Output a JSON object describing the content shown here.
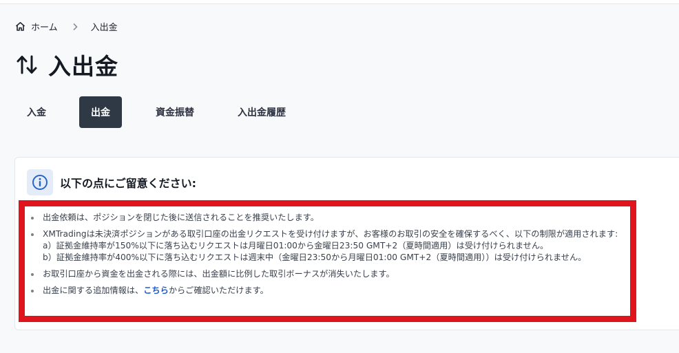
{
  "breadcrumb": {
    "home_label": "ホーム",
    "current_label": "入出金"
  },
  "page": {
    "title": "入出金"
  },
  "tabs": [
    {
      "label": "入金",
      "active": false
    },
    {
      "label": "出金",
      "active": true
    },
    {
      "label": "資金振替",
      "active": false
    },
    {
      "label": "入出金履歴",
      "active": false
    }
  ],
  "notice": {
    "title": "以下の点にご留意ください:",
    "items": [
      "出金依頼は、ポジションを閉じた後に送信されることを推奨いたします。",
      "XMTradingは未決済ポジションがある取引口座の出金リクエストを受け付けますが、お客様のお取引の安全を確保するべく、以下の制限が適用されます:",
      "a）証拠金維持率が150%以下に落ち込むリクエストは月曜日01:00から金曜日23:50 GMT+2（夏時間適用）は受け付けられません。",
      "b）証拠金維持率が400%以下に落ち込むリクエストは週末中（金曜日23:50から月曜日01:00 GMT+2（夏時間適用））は受け付けられません。",
      "お取引口座から資金を出金される際には、出金額に比例した取引ボーナスが消失いたします。"
    ],
    "last_item": {
      "prefix": "出金に関する追加情報は、",
      "link_text": "こちら",
      "suffix": "からご確認いただけます。"
    }
  },
  "colors": {
    "active_tab_bg": "#2f3845",
    "highlight_frame": "#e0141d",
    "link": "#1e5bd0",
    "info_icon": "#2a64c9"
  },
  "icons": {
    "home": "home-icon",
    "separator": "chevron-right-icon",
    "title": "arrows-up-down-icon",
    "notice": "info-circle-icon"
  }
}
